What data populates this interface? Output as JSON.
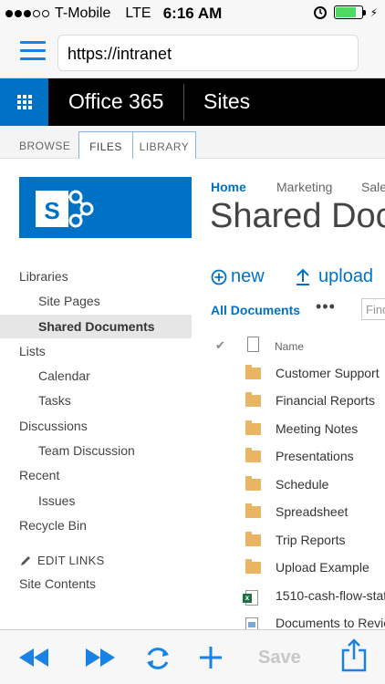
{
  "status_bar": {
    "carrier": "T-Mobile",
    "network": "LTE",
    "time": "6:16 AM"
  },
  "browser": {
    "url": "https://intranet"
  },
  "suite_bar": {
    "app_title": "Office 365",
    "sites_link": "Sites",
    "accent_color": "#0072c6"
  },
  "ribbon": {
    "tabs": [
      "BROWSE",
      "FILES",
      "LIBRARY"
    ]
  },
  "left_nav": {
    "logo_letter": "S",
    "items": [
      {
        "label": "Libraries",
        "level": "heading"
      },
      {
        "label": "Site Pages",
        "level": "sub"
      },
      {
        "label": "Shared Documents",
        "level": "sub",
        "selected": true
      },
      {
        "label": "Lists",
        "level": "heading"
      },
      {
        "label": "Calendar",
        "level": "sub"
      },
      {
        "label": "Tasks",
        "level": "sub"
      },
      {
        "label": "Discussions",
        "level": "heading"
      },
      {
        "label": "Team Discussion",
        "level": "sub"
      },
      {
        "label": "Recent",
        "level": "heading"
      },
      {
        "label": "Issues",
        "level": "sub"
      },
      {
        "label": "Recycle Bin",
        "level": "heading"
      }
    ],
    "edit_links": "EDIT LINKS",
    "site_contents": "Site Contents"
  },
  "main": {
    "breadcrumbs": [
      "Home",
      "Marketing",
      "Sale"
    ],
    "page_title": "Shared Doc",
    "commands": {
      "new": "new",
      "upload": "upload"
    },
    "view_name": "All Documents",
    "find_placeholder": "Find",
    "column_name": "Name",
    "documents": [
      {
        "name": "Customer Support",
        "type": "folder"
      },
      {
        "name": "Financial Reports",
        "type": "folder"
      },
      {
        "name": "Meeting Notes",
        "type": "folder"
      },
      {
        "name": "Presentations",
        "type": "folder"
      },
      {
        "name": "Schedule",
        "type": "folder"
      },
      {
        "name": "Spreadsheet",
        "type": "folder"
      },
      {
        "name": "Trip Reports",
        "type": "folder"
      },
      {
        "name": "Upload Example",
        "type": "folder"
      },
      {
        "name": "1510-cash-flow-stat",
        "type": "excel"
      },
      {
        "name": "Documents to Revie",
        "type": "document"
      }
    ]
  },
  "toolbar": {
    "save_label": "Save",
    "icon_color": "#1a82e2"
  }
}
